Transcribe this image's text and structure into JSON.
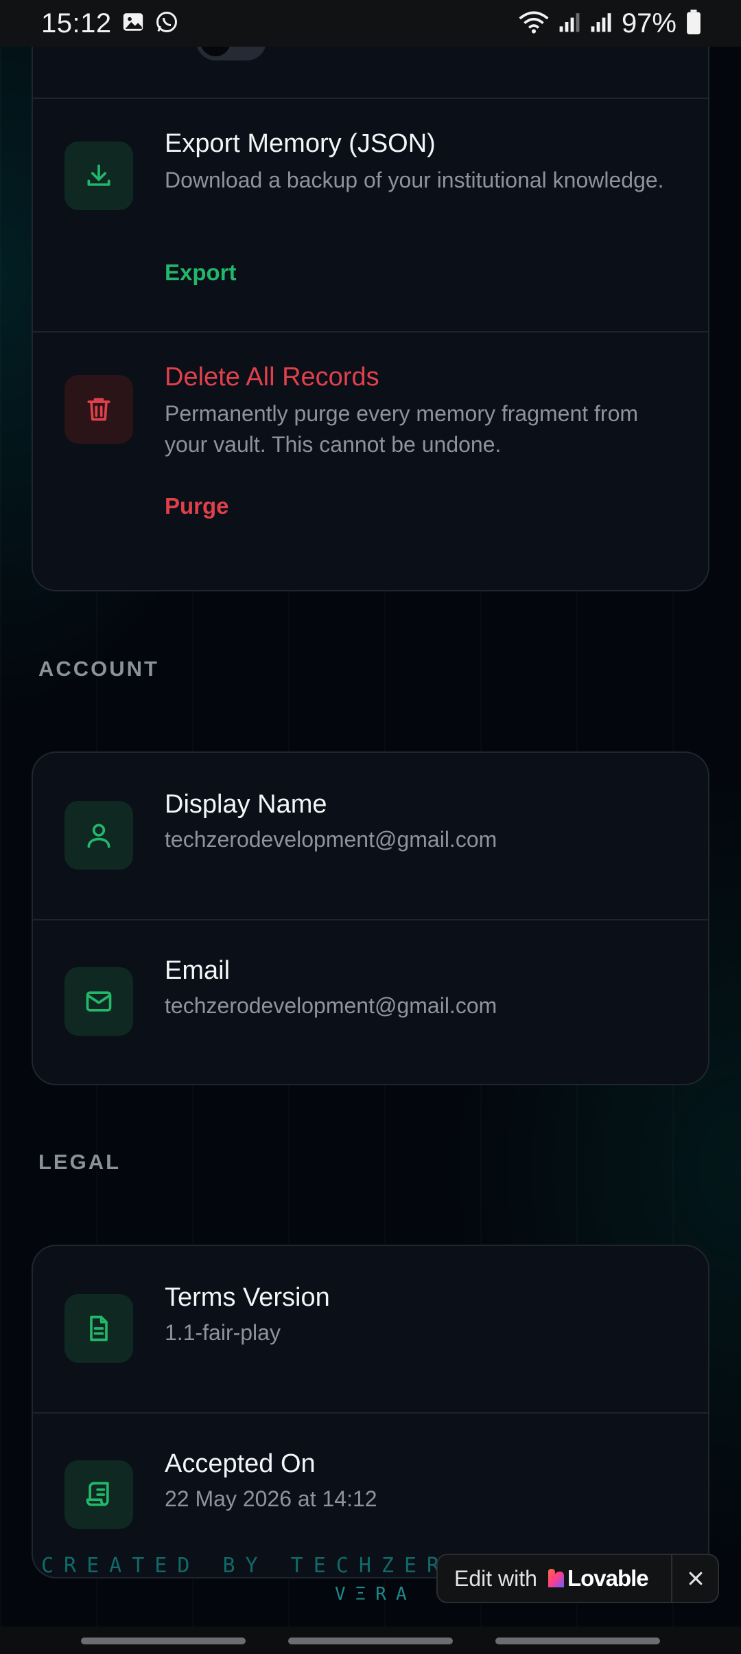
{
  "status_bar": {
    "time": "15:12",
    "battery": "97%",
    "icons": [
      "image-icon",
      "whatsapp-icon",
      "wifi-icon",
      "signal-icon",
      "signal-icon",
      "battery-icon"
    ]
  },
  "data_section": {
    "export": {
      "title": "Export Memory (JSON)",
      "subtitle": "Download a backup of your institutional knowledge.",
      "action": "Export"
    },
    "delete": {
      "title": "Delete All Records",
      "subtitle": "Permanently purge every memory fragment from your vault. This cannot be undone.",
      "action": "Purge"
    }
  },
  "account": {
    "label": "ACCOUNT",
    "display_name": {
      "title": "Display Name",
      "value": "techzerodevelopment@gmail.com"
    },
    "email": {
      "title": "Email",
      "value": "techzerodevelopment@gmail.com"
    }
  },
  "legal": {
    "label": "LEGAL",
    "terms": {
      "title": "Terms Version",
      "value": "1.1-fair-play"
    },
    "accepted": {
      "title": "Accepted On",
      "value": "22 May 2026 at 14:12"
    }
  },
  "footer": {
    "credit": "CREATED BY TECHZERO-DEV",
    "app": "VΞRA"
  },
  "lovable_badge": {
    "edit_label": "Edit with",
    "brand": "Lovable"
  },
  "colors": {
    "accent_green": "#22b86a",
    "danger_red": "#e0404c",
    "card_bg": "#0b0f17"
  }
}
